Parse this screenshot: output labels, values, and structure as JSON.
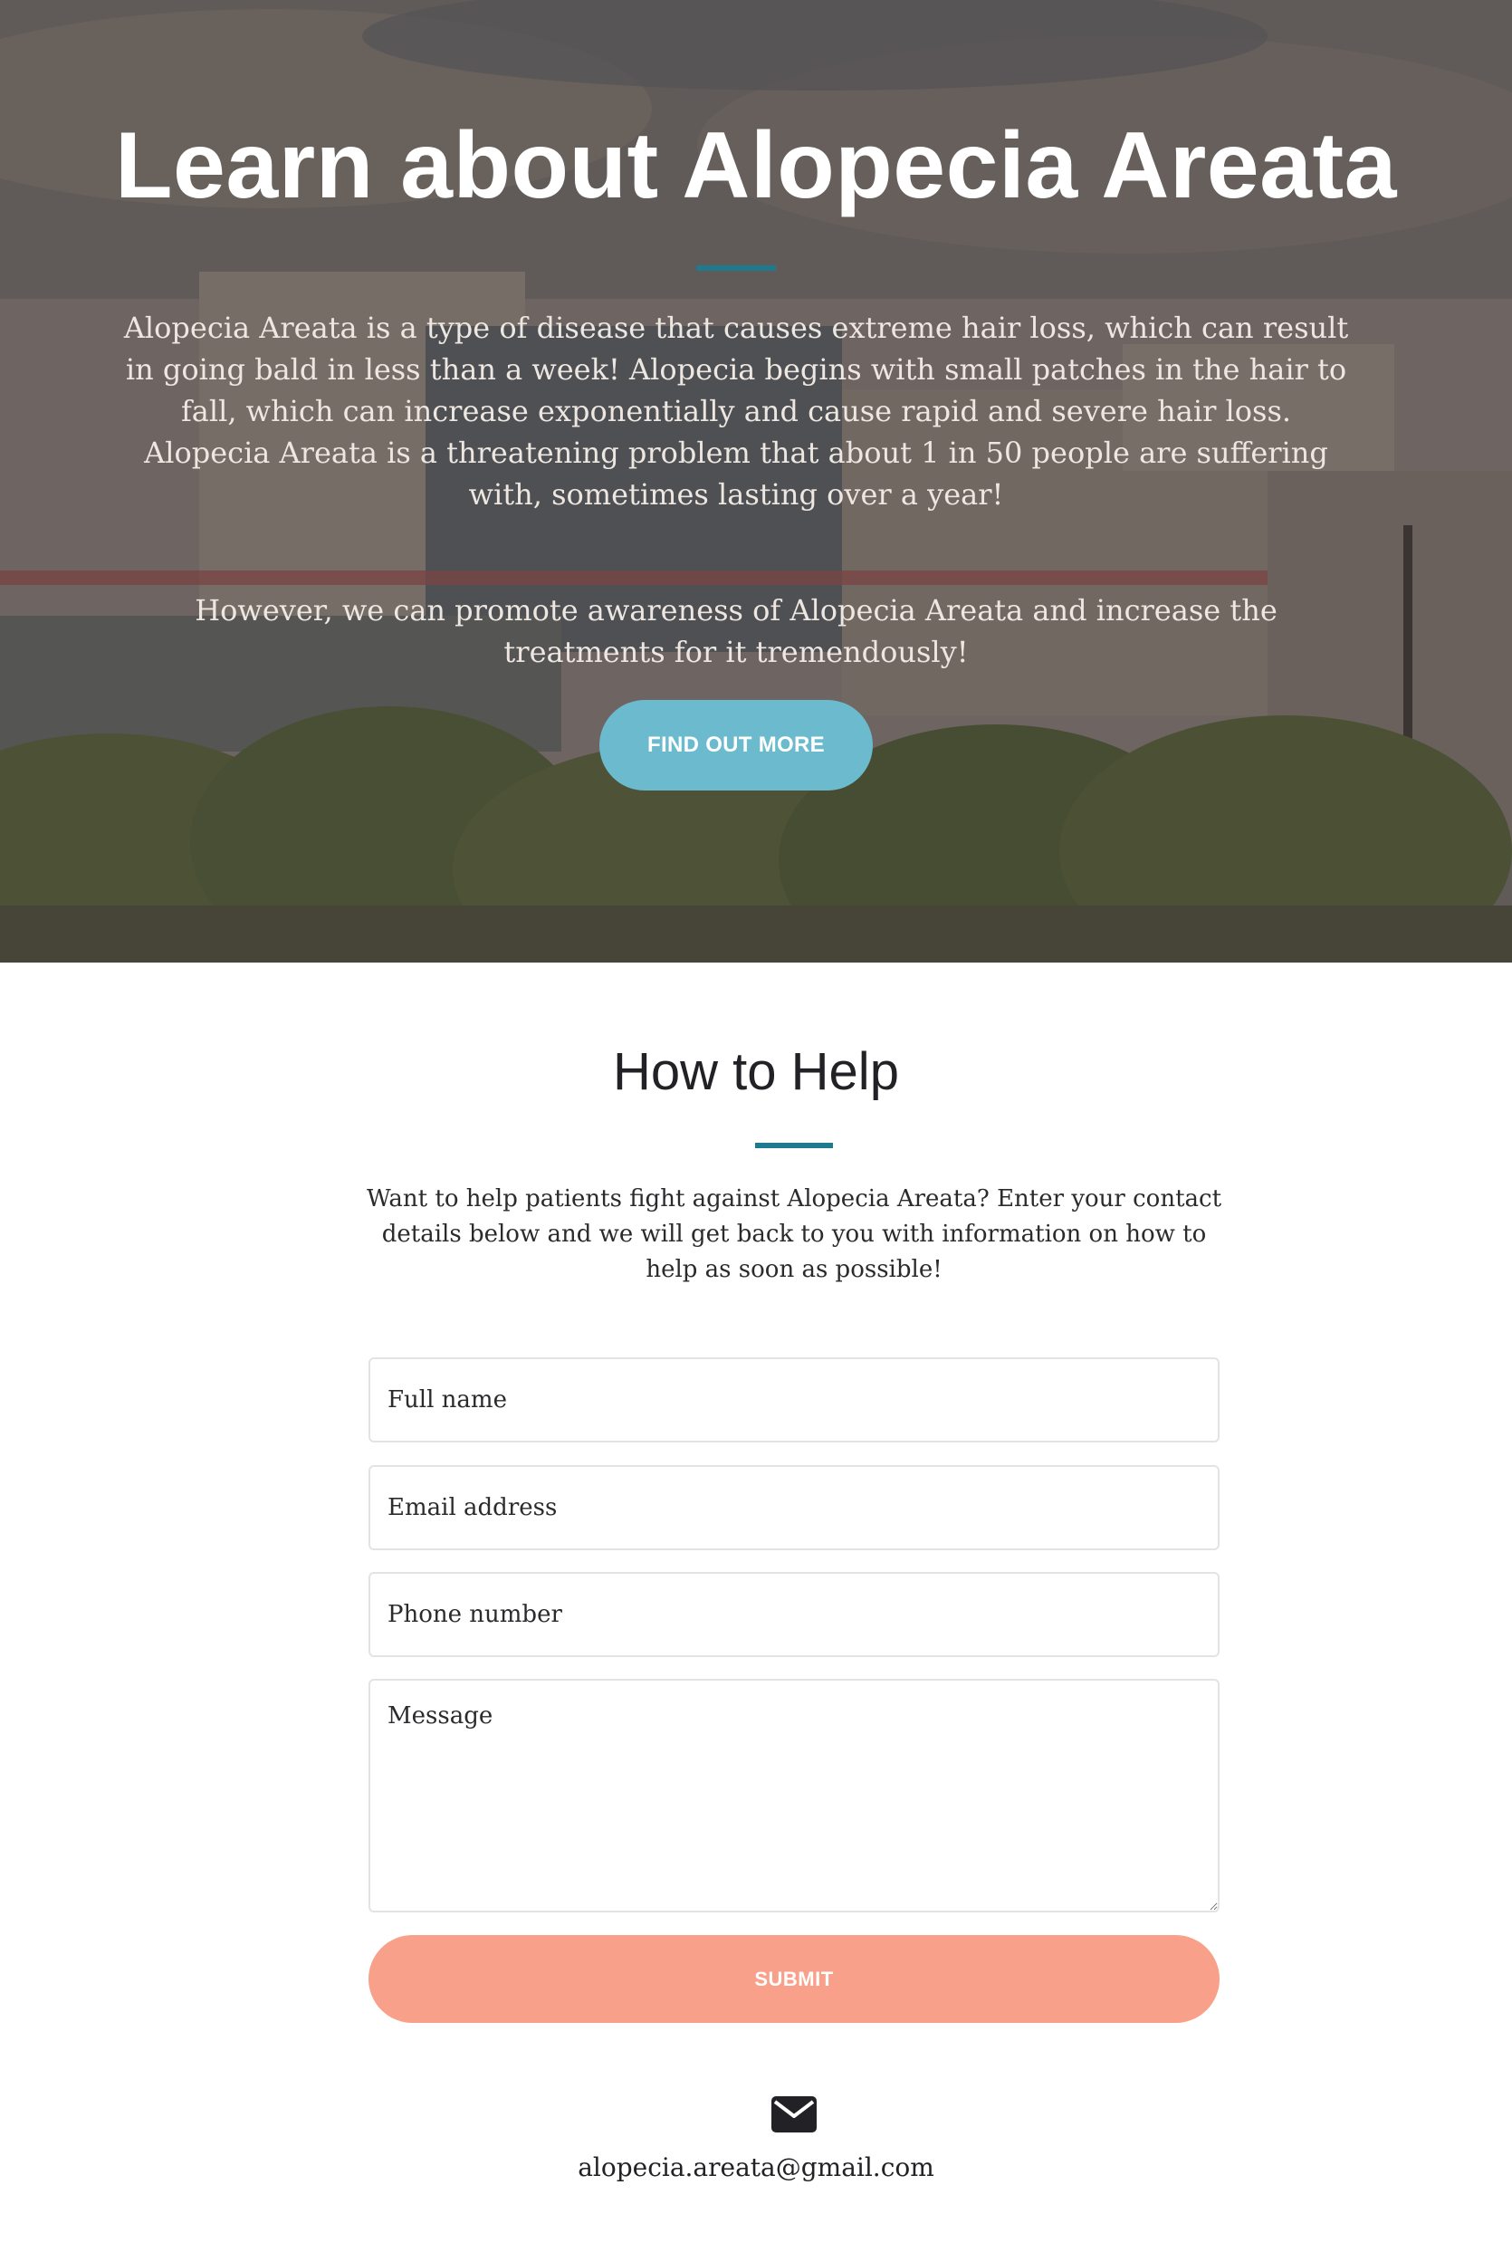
{
  "hero": {
    "title": "Learn about Alopecia Areata",
    "paragraph_1": "Alopecia Areata is a type of disease that causes extreme hair loss, which can result in going bald in less than a week! Alopecia begins with small patches in the hair to fall, which can increase exponentially and cause rapid and severe hair loss. Alopecia Areata is a threatening problem that about 1 in 50 people are suffering with, sometimes lasting over a year!",
    "paragraph_2": "However, we can promote awareness of Alopecia Areata and increase the treatments for it tremendously!",
    "button_label": "FIND OUT MORE",
    "accent_color": "#1f7a8f",
    "button_color": "#6cbace"
  },
  "help": {
    "title": "How to Help",
    "description": "Want to help patients fight against Alopecia Areata? Enter your contact details below and we will get back to you with information on how to help as soon as possible!",
    "form": {
      "name_placeholder": "Full name",
      "email_placeholder": "Email address",
      "phone_placeholder": "Phone number",
      "message_placeholder": "Message",
      "submit_label": "SUBMIT",
      "submit_color": "#f8a08a"
    },
    "contact": {
      "icon": "envelope-icon",
      "email": "alopecia.areata@gmail.com"
    }
  }
}
